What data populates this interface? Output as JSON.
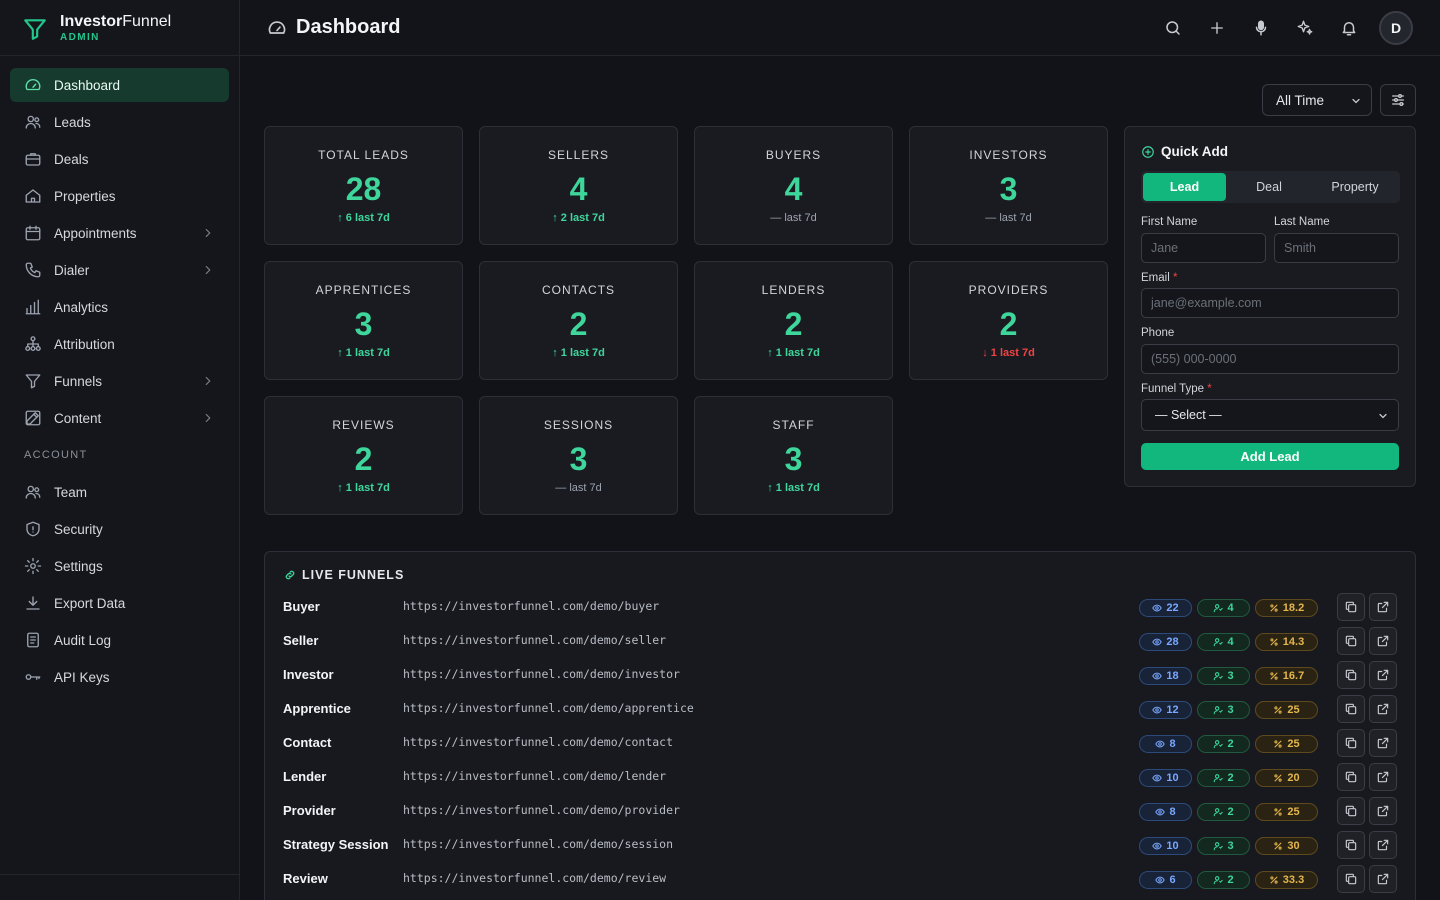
{
  "brand": {
    "name_bold": "Investor",
    "name_light": "Funnel",
    "role": "ADMIN"
  },
  "nav": {
    "items": [
      {
        "label": "Dashboard",
        "icon": "gauge-icon",
        "active": true,
        "chevron": false
      },
      {
        "label": "Leads",
        "icon": "users-icon",
        "active": false,
        "chevron": false
      },
      {
        "label": "Deals",
        "icon": "briefcase-icon",
        "active": false,
        "chevron": false
      },
      {
        "label": "Properties",
        "icon": "home-icon",
        "active": false,
        "chevron": false
      },
      {
        "label": "Appointments",
        "icon": "calendar-icon",
        "active": false,
        "chevron": true
      },
      {
        "label": "Dialer",
        "icon": "phone-icon",
        "active": false,
        "chevron": true
      },
      {
        "label": "Analytics",
        "icon": "bar-chart-icon",
        "active": false,
        "chevron": false
      },
      {
        "label": "Attribution",
        "icon": "network-icon",
        "active": false,
        "chevron": false
      },
      {
        "label": "Funnels",
        "icon": "funnel-icon",
        "active": false,
        "chevron": true
      },
      {
        "label": "Content",
        "icon": "edit-icon",
        "active": false,
        "chevron": true
      }
    ],
    "section_label": "ACCOUNT",
    "account_items": [
      {
        "label": "Team",
        "icon": "team-icon"
      },
      {
        "label": "Security",
        "icon": "shield-icon"
      },
      {
        "label": "Settings",
        "icon": "gear-icon"
      },
      {
        "label": "Export Data",
        "icon": "download-icon"
      },
      {
        "label": "Audit Log",
        "icon": "log-icon"
      },
      {
        "label": "API Keys",
        "icon": "key-icon"
      }
    ]
  },
  "header": {
    "title": "Dashboard",
    "avatar_initial": "D"
  },
  "filters": {
    "range": "All Time"
  },
  "stats": [
    {
      "label": "TOTAL LEADS",
      "value": "28",
      "delta": "6 last 7d",
      "trend": "up"
    },
    {
      "label": "SELLERS",
      "value": "4",
      "delta": "2 last 7d",
      "trend": "up"
    },
    {
      "label": "BUYERS",
      "value": "4",
      "delta": "— last 7d",
      "trend": "flat"
    },
    {
      "label": "INVESTORS",
      "value": "3",
      "delta": "— last 7d",
      "trend": "flat"
    },
    {
      "label": "APPRENTICES",
      "value": "3",
      "delta": "1 last 7d",
      "trend": "up"
    },
    {
      "label": "CONTACTS",
      "value": "2",
      "delta": "1 last 7d",
      "trend": "up"
    },
    {
      "label": "LENDERS",
      "value": "2",
      "delta": "1 last 7d",
      "trend": "up"
    },
    {
      "label": "PROVIDERS",
      "value": "2",
      "delta": "1 last 7d",
      "trend": "down"
    },
    {
      "label": "REVIEWS",
      "value": "2",
      "delta": "1 last 7d",
      "trend": "up"
    },
    {
      "label": "SESSIONS",
      "value": "3",
      "delta": "— last 7d",
      "trend": "flat"
    },
    {
      "label": "STAFF",
      "value": "3",
      "delta": "1 last 7d",
      "trend": "up"
    }
  ],
  "quick_add": {
    "title": "Quick Add",
    "tabs": [
      "Lead",
      "Deal",
      "Property"
    ],
    "first_name": {
      "label": "First Name",
      "placeholder": "Jane"
    },
    "last_name": {
      "label": "Last Name",
      "placeholder": "Smith"
    },
    "email": {
      "label": "Email",
      "required_mark": "*",
      "placeholder": "jane@example.com"
    },
    "phone": {
      "label": "Phone",
      "placeholder": "(555) 000-0000"
    },
    "funnel_type": {
      "label": "Funnel Type",
      "required_mark": "*",
      "selected": "— Select —"
    },
    "submit_label": "Add Lead"
  },
  "live_funnels": {
    "title": "LIVE FUNNELS",
    "rows": [
      {
        "name": "Buyer",
        "url": "https://investorfunnel.com/demo/buyer",
        "views": "22",
        "leads": "4",
        "rate": "18.2"
      },
      {
        "name": "Seller",
        "url": "https://investorfunnel.com/demo/seller",
        "views": "28",
        "leads": "4",
        "rate": "14.3"
      },
      {
        "name": "Investor",
        "url": "https://investorfunnel.com/demo/investor",
        "views": "18",
        "leads": "3",
        "rate": "16.7"
      },
      {
        "name": "Apprentice",
        "url": "https://investorfunnel.com/demo/apprentice",
        "views": "12",
        "leads": "3",
        "rate": "25"
      },
      {
        "name": "Contact",
        "url": "https://investorfunnel.com/demo/contact",
        "views": "8",
        "leads": "2",
        "rate": "25"
      },
      {
        "name": "Lender",
        "url": "https://investorfunnel.com/demo/lender",
        "views": "10",
        "leads": "2",
        "rate": "20"
      },
      {
        "name": "Provider",
        "url": "https://investorfunnel.com/demo/provider",
        "views": "8",
        "leads": "2",
        "rate": "25"
      },
      {
        "name": "Strategy Session",
        "url": "https://investorfunnel.com/demo/session",
        "views": "10",
        "leads": "3",
        "rate": "30"
      },
      {
        "name": "Review",
        "url": "https://investorfunnel.com/demo/review",
        "views": "6",
        "leads": "2",
        "rate": "33.3"
      }
    ]
  },
  "colors": {
    "accent": "#12b77d",
    "accent_text": "#3ed69b",
    "down": "#ef4444",
    "views": "#7aa7ff",
    "rate": "#e5b64a"
  }
}
